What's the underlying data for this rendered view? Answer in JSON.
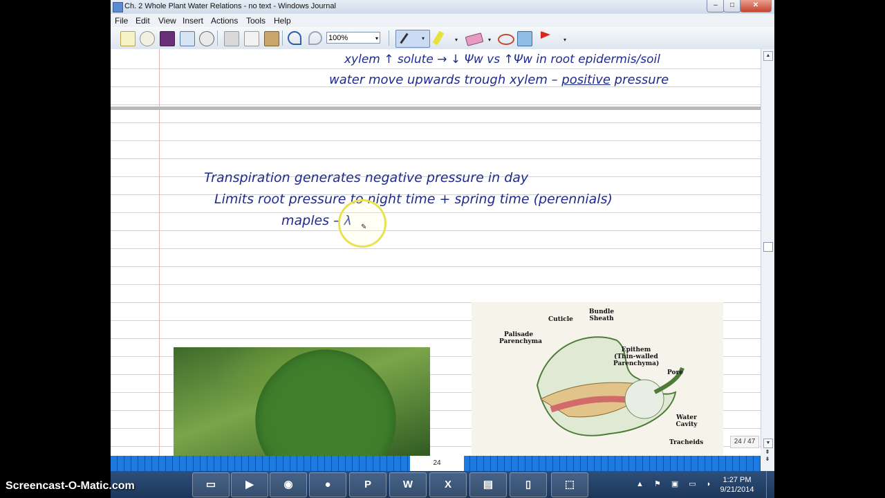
{
  "window": {
    "title": "Ch. 2 Whole Plant Water Relations - no text - Windows Journal"
  },
  "menu": {
    "items": [
      "File",
      "Edit",
      "View",
      "Insert",
      "Actions",
      "Tools",
      "Help"
    ]
  },
  "toolbar": {
    "zoom_value": "100%",
    "zoom_arrow": "▾"
  },
  "window_buttons": {
    "minimize": "–",
    "maximize": "□",
    "close": "✕"
  },
  "handwriting": {
    "line1": "xylem ↑ solute → ↓ Ψw  vs  ↑Ψw in root epidermis/soil",
    "line2": "water move upwards trough xylem – ",
    "line2_underlined": "positive",
    "line2_end": " pressure",
    "line3": "Transpiration generates negative pressure in day",
    "line4": "Limits root pressure to night time + spring time (perennials)",
    "line5": "maples  – λ"
  },
  "diagram": {
    "labels": [
      "Cuticle",
      "Bundle Sheath",
      "Palisade Parenchyma",
      "Epithem (Thin-walled Parenchyma)",
      "Pore",
      "Water Cavity",
      "Tracheids"
    ]
  },
  "page_indicator": "24 / 47",
  "page_tab": "24",
  "taskbar": {
    "clock_time": "1:27 PM",
    "clock_date": "9/21/2014"
  },
  "watermark": "Screencast-O-Matic.com",
  "colors": {
    "ink": "#1e2a90",
    "highlight": "#e8e24f",
    "taskbar": "#1c3659"
  }
}
